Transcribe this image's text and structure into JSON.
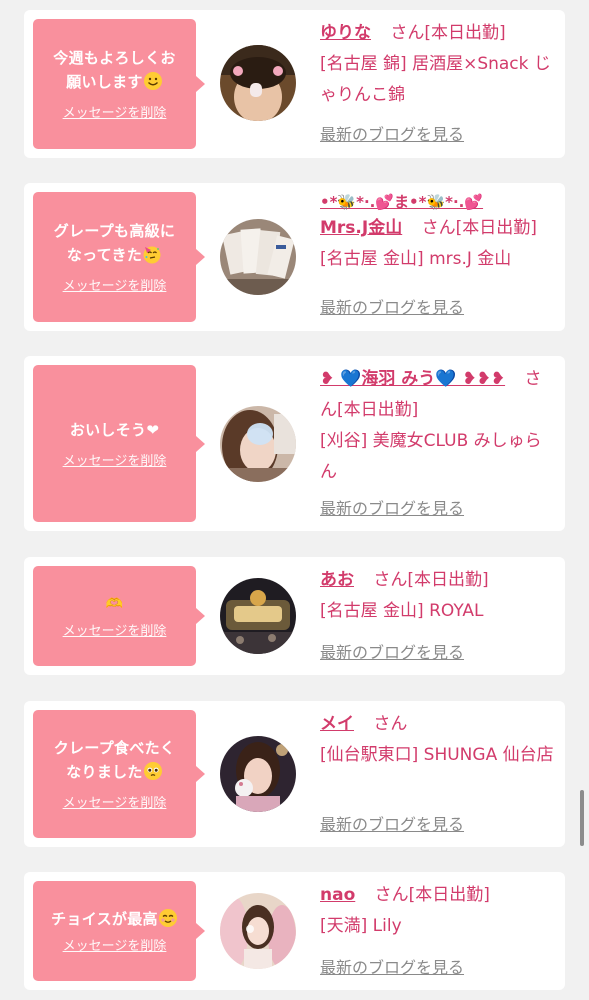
{
  "colors": {
    "page_bg": "#f1f1f1",
    "card_bg": "#ffffff",
    "bubble": "#f9909d",
    "accent_text": "#d23b6b",
    "blog_link": "#8a8a8a"
  },
  "common": {
    "delete_label": "メッセージを削除",
    "blog_label": "最新のブログを見る"
  },
  "cards": [
    {
      "message_lines": [
        "今週もよろしくお",
        "願いします"
      ],
      "message_emoji": "smiling-face-icon",
      "name": "ゆりな",
      "suffix": "さん[本日出勤]",
      "shop": "[名古屋 錦] 居酒屋×Snack じゃりんこ錦"
    },
    {
      "message_lines": [
        "グレープも高級に",
        "なってきた"
      ],
      "message_emoji": "partying-face-icon",
      "name_decor": "•*🐝*·.💕ま•*🐝*·.💕",
      "name": "Mrs.J金山",
      "suffix": "さん[本日出勤]",
      "shop": "[名古屋 金山] mrs.J 金山"
    },
    {
      "message_lines": [
        "おいしそう❤"
      ],
      "name": "❥ 💙海羽 みう💙 ❥❥❥",
      "suffix": "さん[本日出勤]",
      "shop": "[刈谷] 美魔女CLUB みしゅらん"
    },
    {
      "message_lines": [
        "🫶"
      ],
      "name": "あお",
      "suffix": "さん[本日出勤]",
      "shop": "[名古屋 金山] ROYAL"
    },
    {
      "message_lines": [
        "クレープ食べたく",
        "なりました"
      ],
      "message_emoji": "pleading-face-icon",
      "name": "メイ",
      "suffix": "さん",
      "shop": "[仙台駅東口] SHUNGA 仙台店"
    },
    {
      "message_lines": [
        "チョイスが最高"
      ],
      "message_emoji": "relieved-face-icon",
      "name": "nao",
      "suffix": "さん[本日出勤]",
      "shop": "[天満] Lily"
    }
  ]
}
